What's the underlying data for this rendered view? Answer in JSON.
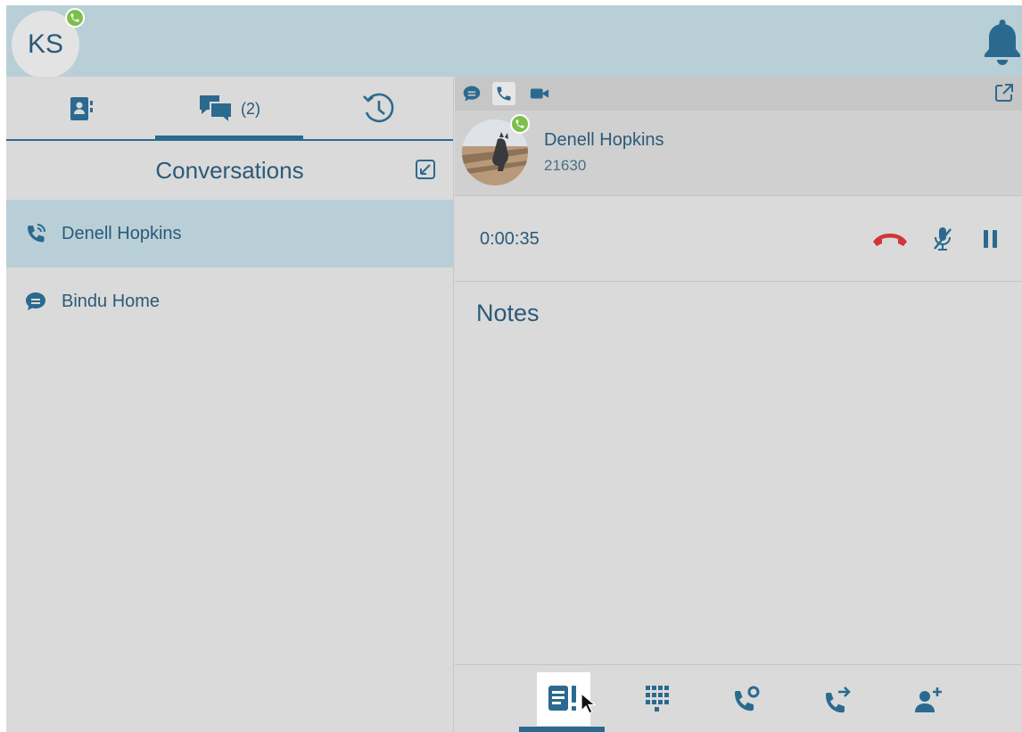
{
  "header": {
    "user_initials": "KS",
    "status": "on-call",
    "icons": [
      "phone-status-icon",
      "bell-icon"
    ]
  },
  "left_panel": {
    "tabs": [
      {
        "name": "contacts",
        "icon": "contacts-icon"
      },
      {
        "name": "conversations",
        "icon": "chat-bubbles-icon",
        "count": "(2)",
        "active": true
      },
      {
        "name": "history",
        "icon": "history-clock-icon"
      }
    ],
    "title": "Conversations",
    "conversations": [
      {
        "name": "Denell Hopkins",
        "icon": "active-call-icon",
        "selected": true
      },
      {
        "name": "Bindu Home",
        "icon": "chat-icon",
        "selected": false
      }
    ]
  },
  "right_panel": {
    "channels": [
      "chat-icon",
      "phone-icon",
      "video-icon"
    ],
    "contact": {
      "name": "Denell Hopkins",
      "extension": "21630"
    },
    "call": {
      "timer": "0:00:35"
    },
    "notes_label": "Notes",
    "toolbar": [
      "notes-icon",
      "dialpad-icon",
      "call-park-icon",
      "call-transfer-icon",
      "add-person-icon"
    ]
  },
  "colors": {
    "primary": "#2b5a78",
    "header_bg": "#b9cfd7",
    "panel_bg": "#dadada",
    "presence_green": "#7cc04b",
    "hangup_red": "#d0363a"
  }
}
